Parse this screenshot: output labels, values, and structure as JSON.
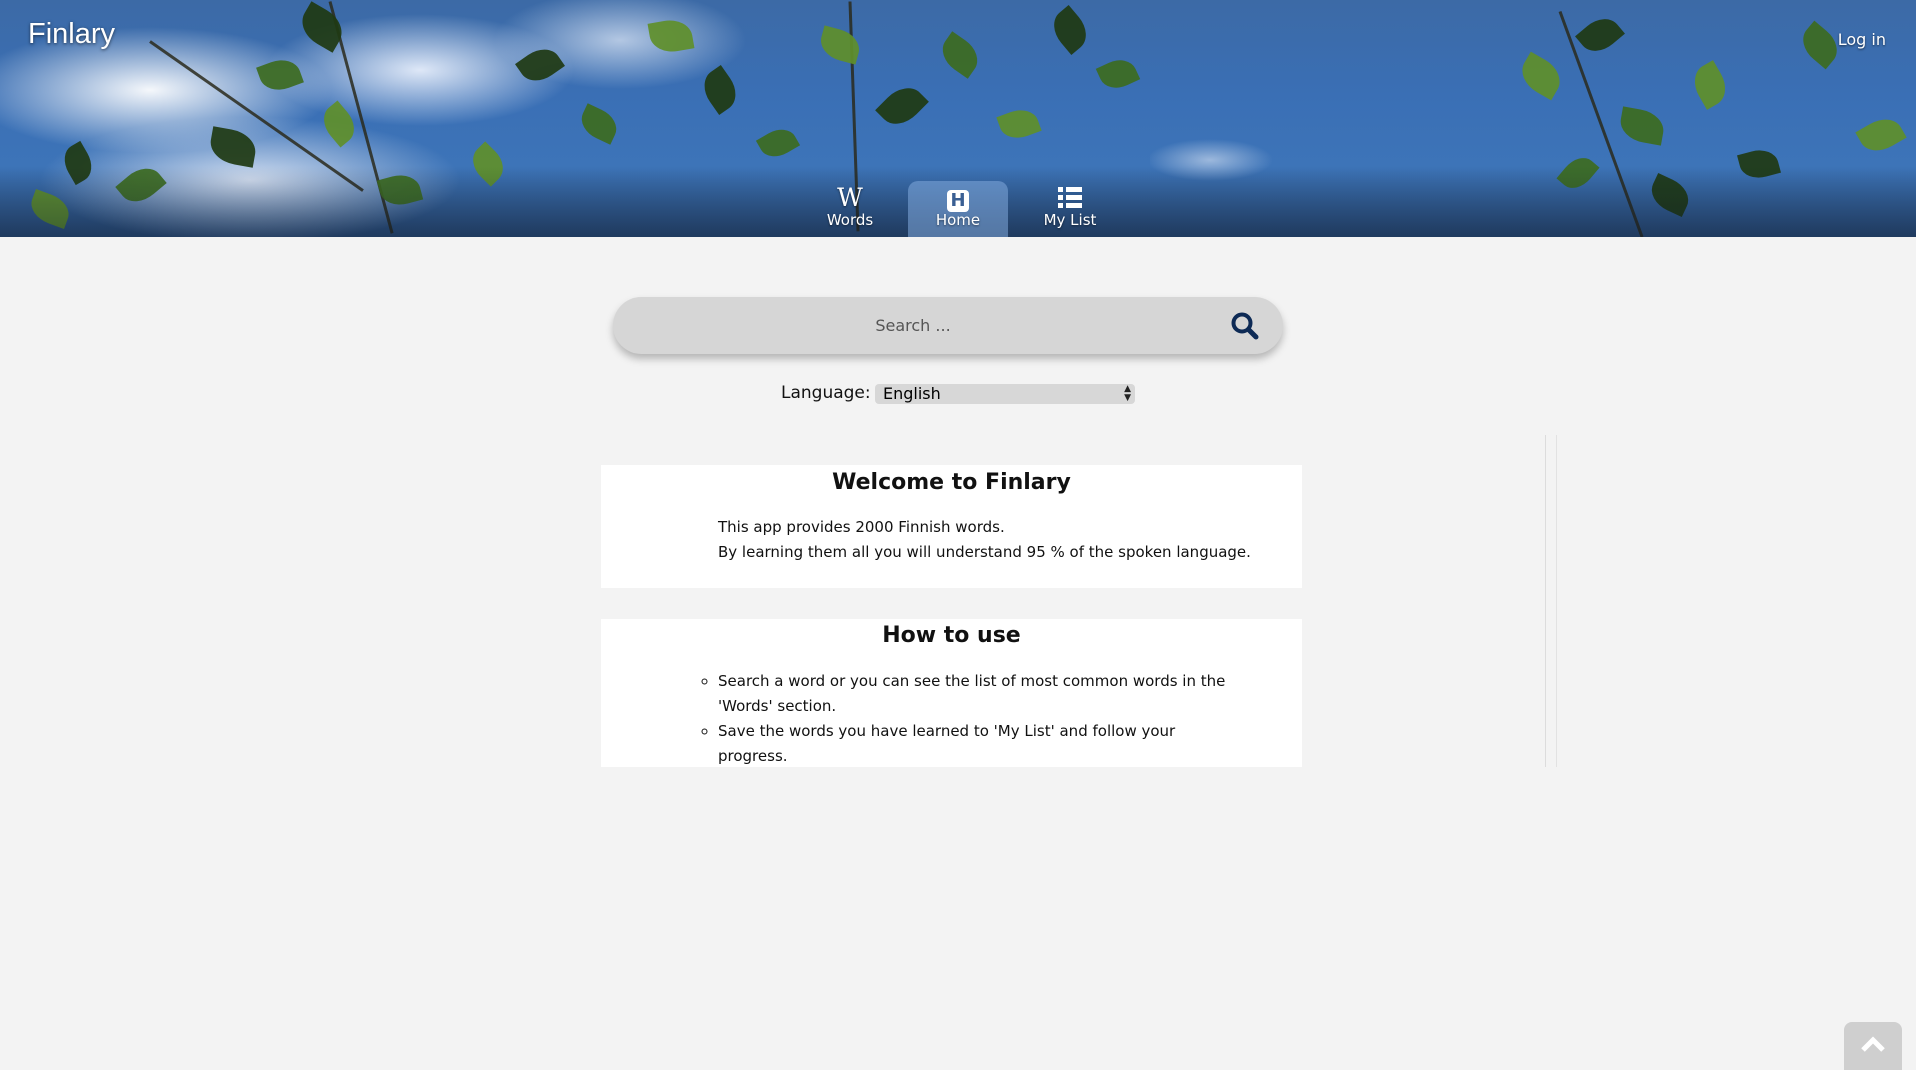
{
  "app": {
    "brand": "Finlary",
    "login_label": "Log in"
  },
  "nav": {
    "items": [
      {
        "label": "Words",
        "icon": "wikipedia-w-icon",
        "active": false
      },
      {
        "label": "Home",
        "icon": "home-h-icon",
        "active": true
      },
      {
        "label": "My List",
        "icon": "list-icon",
        "active": false
      }
    ]
  },
  "search": {
    "placeholder": "Search ...",
    "value": ""
  },
  "language": {
    "label": "Language:",
    "selected": "English"
  },
  "welcome": {
    "title": "Welcome to Finlary",
    "line1": "This app provides 2000 Finnish words.",
    "line2": "By learning them all you will understand 95 % of the spoken language."
  },
  "howto": {
    "title": "How to use",
    "items": [
      "Search a word or you can see the list of most common words in the 'Words' section.",
      "Save the words you have learned to 'My List' and follow your progress."
    ]
  },
  "colors": {
    "accent": "#1f5fd6",
    "background": "#f3f3f3",
    "search_icon": "#0d2a55"
  }
}
